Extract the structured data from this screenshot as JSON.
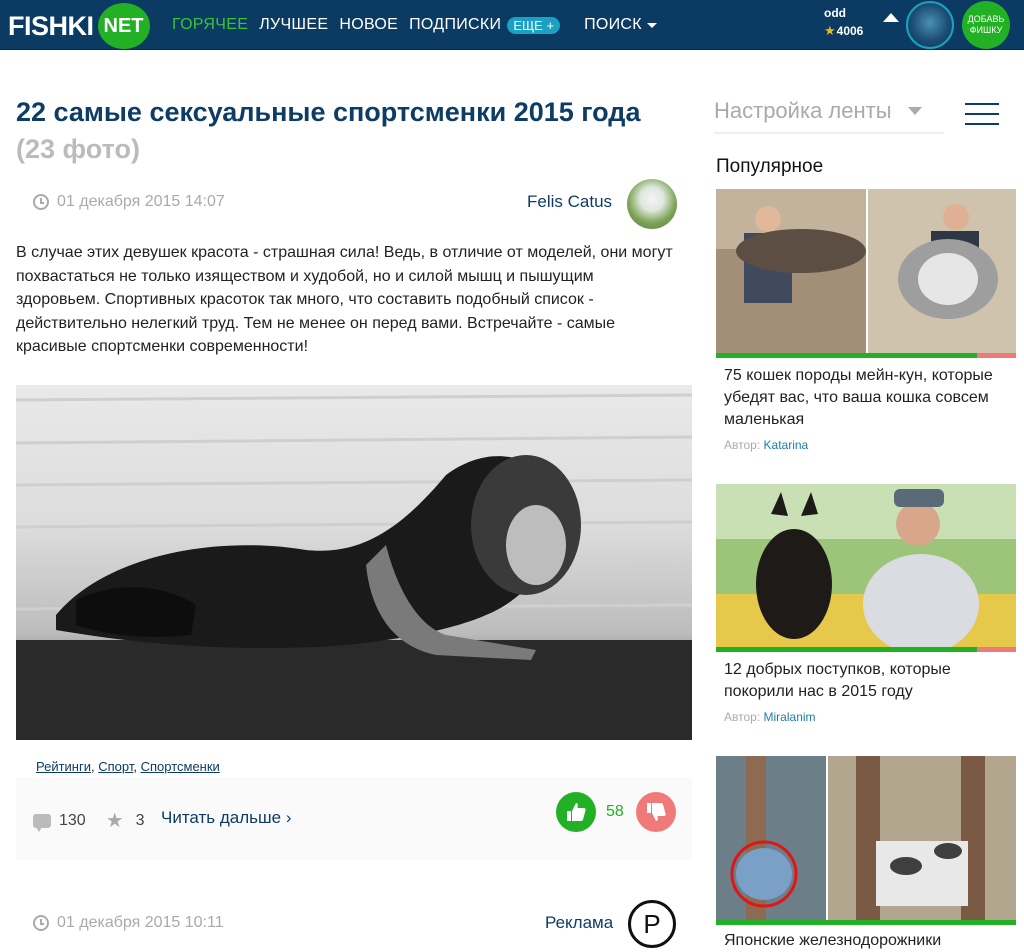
{
  "header": {
    "logo_text": "FISHKI",
    "logo_badge": "NET",
    "nav": [
      "ГОРЯЧЕЕ",
      "ЛУЧШЕЕ",
      "НОВОЕ",
      "ПОДПИСКИ"
    ],
    "nav_more": "ЕЩЕ +",
    "search": "ПОИСК",
    "username": "odd",
    "score": "4006",
    "add_button": "ДОБАВЬ ФИШКУ",
    "accent_color": "#22b024",
    "brand_color": "#0b3a63"
  },
  "article": {
    "title": "22 самые сексуальные спортсменки 2015 года",
    "photo_count": "(23 фото)",
    "date": "01 декабря 2015 14:07",
    "author": "Felis Catus",
    "lead": "В случае этих девушек красота - страшная сила! Ведь, в отличие от моделей, они могут похвастаться не только изяществом и худобой, но и силой мышц и пышущим здоровьем. Спортивных красоток так много, что составить подобный список - действительно нелегкий труд. Тем не менее он перед вами. Встречайте - самые красивые спортсменки современности!",
    "tags": [
      "Рейтинги",
      "Спорт",
      "Спортсменки"
    ],
    "comments": "130",
    "favorites": "3",
    "read_more": "Читать дальше ›",
    "votes": "58"
  },
  "next_item": {
    "date": "01 декабря 2015 10:11",
    "label": "Реклама",
    "icon_letter": "P"
  },
  "sidebar": {
    "feed_settings": "Настройка ленты",
    "popular_title": "Популярное",
    "author_prefix": "Автор:",
    "cards": [
      {
        "title": "75 кошек породы мейн-кун, которые убедят вас, что ваша кошка совсем маленькая",
        "author": "Katarina",
        "rating_positive": 0.87
      },
      {
        "title": "12 добрых поступков, которые покорили нас в 2015 году",
        "author": "Miralanim",
        "rating_positive": 0.87
      },
      {
        "title": "Японские железнодорожники",
        "author": "",
        "rating_positive": 1.0
      }
    ]
  }
}
